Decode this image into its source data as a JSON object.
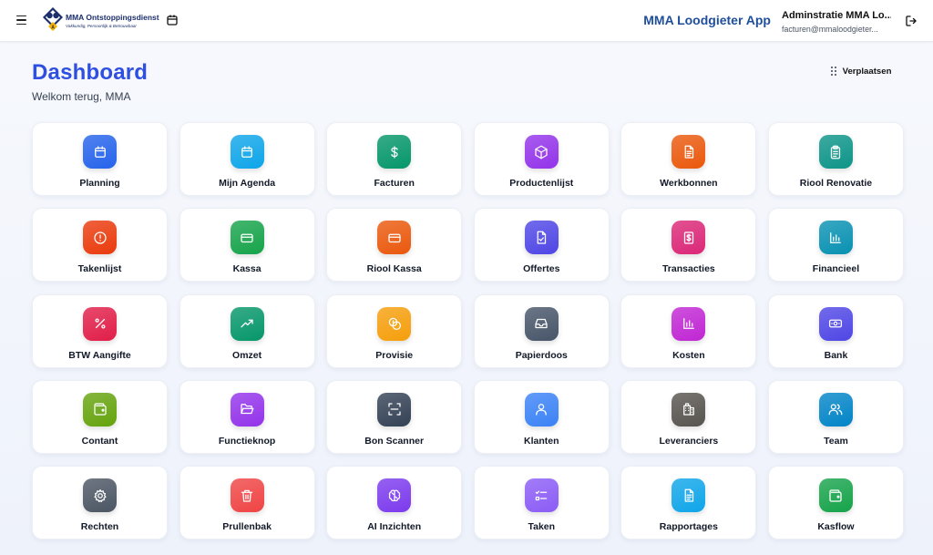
{
  "header": {
    "brand_name": "MMA Ontstoppingsdienst",
    "brand_tagline": "Vakkundig, Persoonlijk & Betrouwbaar",
    "app_title": "MMA Loodgieter App",
    "user_name": "Adminstratie MMA Lo...",
    "user_email": "facturen@mmaloodgieter..."
  },
  "page": {
    "title": "Dashboard",
    "subtitle": "Welkom terug, MMA",
    "move_label": "Verplaatsen"
  },
  "tiles": [
    {
      "label": "Planning",
      "icon": "calendar-icon",
      "color": "#2563eb"
    },
    {
      "label": "Mijn Agenda",
      "icon": "calendar-icon",
      "color": "#0ea5e9"
    },
    {
      "label": "Facturen",
      "icon": "dollar-icon",
      "color": "#059669"
    },
    {
      "label": "Productenlijst",
      "icon": "box-icon",
      "color": "#9333ea"
    },
    {
      "label": "Werkbonnen",
      "icon": "document-icon",
      "color": "#ea580c"
    },
    {
      "label": "Riool Renovatie",
      "icon": "clipboard-icon",
      "color": "#0d9488"
    },
    {
      "label": "Takenlijst",
      "icon": "alert-icon",
      "color": "#ea3a0c"
    },
    {
      "label": "Kassa",
      "icon": "card-icon",
      "color": "#16a34a"
    },
    {
      "label": "Riool Kassa",
      "icon": "card-icon",
      "color": "#ea580c"
    },
    {
      "label": "Offertes",
      "icon": "file-check-icon",
      "color": "#4f46e5"
    },
    {
      "label": "Transacties",
      "icon": "receipt-icon",
      "color": "#db2777"
    },
    {
      "label": "Financieel",
      "icon": "bar-chart-icon",
      "color": "#0891b2"
    },
    {
      "label": "BTW Aangifte",
      "icon": "percent-icon",
      "color": "#e11d48"
    },
    {
      "label": "Omzet",
      "icon": "trending-up-icon",
      "color": "#059669"
    },
    {
      "label": "Provisie",
      "icon": "coins-icon",
      "color": "#f59e0b"
    },
    {
      "label": "Papierdoos",
      "icon": "inbox-icon",
      "color": "#475569"
    },
    {
      "label": "Kosten",
      "icon": "bar-chart-icon",
      "color": "#c026d3"
    },
    {
      "label": "Bank",
      "icon": "banknote-icon",
      "color": "#4f46e5"
    },
    {
      "label": "Contant",
      "icon": "wallet-icon",
      "color": "#65a30d"
    },
    {
      "label": "Functieknop",
      "icon": "folder-icon",
      "color": "#9333ea"
    },
    {
      "label": "Bon Scanner",
      "icon": "scan-icon",
      "color": "#334155"
    },
    {
      "label": "Klanten",
      "icon": "user-icon",
      "color": "#3b82f6"
    },
    {
      "label": "Leveranciers",
      "icon": "building-icon",
      "color": "#57534e"
    },
    {
      "label": "Team",
      "icon": "users-icon",
      "color": "#0284c7"
    },
    {
      "label": "Rechten",
      "icon": "gear-icon",
      "color": "#4b5563"
    },
    {
      "label": "Prullenbak",
      "icon": "trash-icon",
      "color": "#ef4444"
    },
    {
      "label": "AI Inzichten",
      "icon": "brain-icon",
      "color": "#7c3aed"
    },
    {
      "label": "Taken",
      "icon": "list-check-icon",
      "color": "#8b5cf6"
    },
    {
      "label": "Rapportages",
      "icon": "document-icon",
      "color": "#0ea5e9"
    },
    {
      "label": "Kasflow",
      "icon": "wallet-icon",
      "color": "#16a34a"
    }
  ]
}
